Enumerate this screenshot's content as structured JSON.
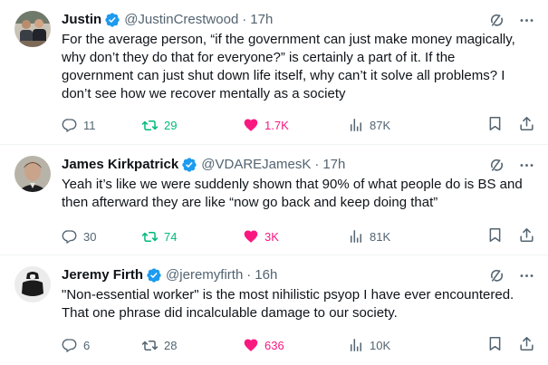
{
  "colors": {
    "accent_blue": "#1d9bf0",
    "retweet_green": "#00ba7c",
    "like_pink": "#f91880",
    "muted_text": "#536471"
  },
  "tweets": [
    {
      "name": "Justin",
      "handle": "@JustinCrestwood",
      "dot": "·",
      "time": "17h",
      "text": "For the average person, “if the government can just make money magically, why don’t they do that for everyone?” is certainly a part of it. If the government can just shut down life itself, why can’t it solve all problems? I don’t see how we recover mentally as a society",
      "replies": "11",
      "retweets": "29",
      "likes": "1.7K",
      "views": "87K"
    },
    {
      "name": "James Kirkpatrick",
      "handle": "@VDAREJamesK",
      "dot": "·",
      "time": "17h",
      "text": "Yeah it’s like we were suddenly shown that 90% of what people do is BS and then afterward they are like “now go back and keep doing that”",
      "replies": "30",
      "retweets": "74",
      "likes": "3K",
      "views": "81K"
    },
    {
      "name": "Jeremy Firth",
      "handle": "@jeremyfirth",
      "dot": "·",
      "time": "16h",
      "text": "\"Non-essential worker\" is the most nihilistic psyop I have ever encountered. That one phrase did incalculable damage to our society.",
      "replies": "6",
      "retweets": "28",
      "likes": "636",
      "views": "10K"
    }
  ]
}
